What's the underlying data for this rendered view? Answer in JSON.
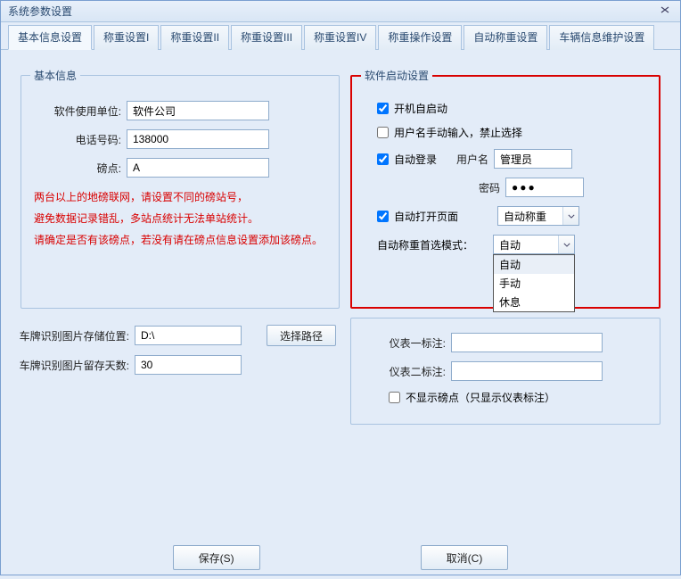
{
  "window": {
    "title": "系统参数设置"
  },
  "tabs": [
    "基本信息设置",
    "称重设置I",
    "称重设置II",
    "称重设置III",
    "称重设置IV",
    "称重操作设置",
    "自动称重设置",
    "车辆信息维护设置"
  ],
  "basicInfo": {
    "legend": "基本信息",
    "company_label": "软件使用单位:",
    "company_value": "软件公司",
    "phone_label": "电话号码:",
    "phone_value": "138000",
    "scale_label": "磅点:",
    "scale_value": "A",
    "warning1": "两台以上的地磅联网，请设置不同的磅站号，",
    "warning2": "避免数据记录错乱，多站点统计无法单站统计。",
    "warning3": "请确定是否有该磅点，若没有请在磅点信息设置添加该磅点。"
  },
  "startup": {
    "legend": "软件启动设置",
    "auto_start_label": "开机自启动",
    "manual_user_label": "用户名手动输入，禁止选择",
    "auto_login_label": "自动登录",
    "username_label": "用户名",
    "username_value": "管理员",
    "password_label": "密码",
    "password_value": "●●●",
    "auto_open_label": "自动打开页面",
    "auto_open_value": "自动称重",
    "mode_label": "自动称重首选模式：",
    "mode_value": "自动",
    "mode_options": [
      "自动",
      "手动",
      "休息"
    ]
  },
  "plateImg": {
    "path_label": "车牌识别图片存储位置:",
    "path_value": "D:\\",
    "browse_label": "选择路径",
    "days_label": "车牌识别图片留存天数:",
    "days_value": "30"
  },
  "meter": {
    "label1": "仪表一标注:",
    "label2": "仪表二标注:",
    "hide_scale_label": "不显示磅点（只显示仪表标注）"
  },
  "footer": {
    "save": "保存(S)",
    "cancel": "取消(C)"
  }
}
